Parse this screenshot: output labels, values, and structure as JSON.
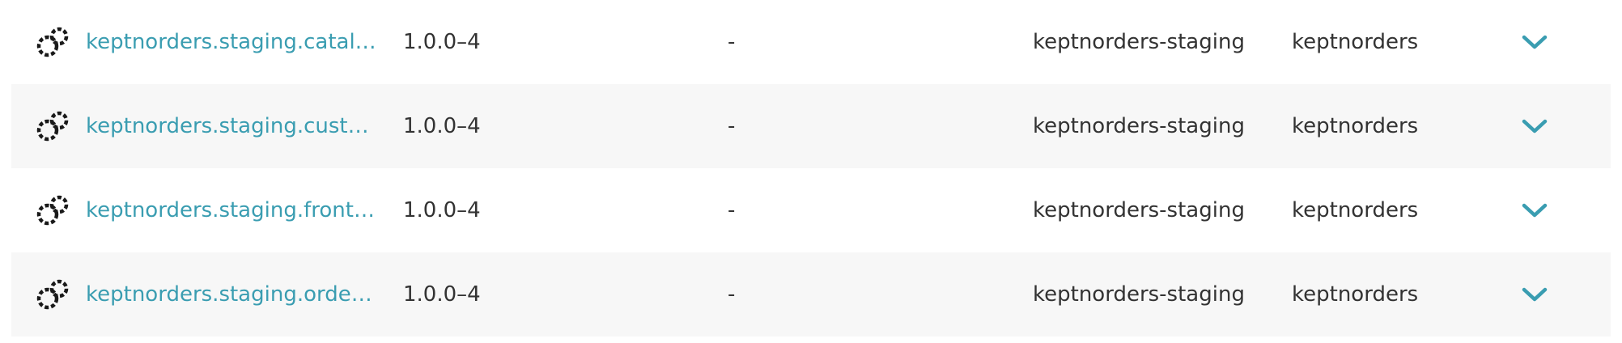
{
  "rows": [
    {
      "name": "keptnorders.staging.catal…",
      "version": "1.0.0–4",
      "value": "-",
      "namespace": "keptnorders-staging",
      "app": "keptnorders",
      "icon": "workload-cycle-icon",
      "expand_icon": "chevron-down-icon"
    },
    {
      "name": "keptnorders.staging.cust…",
      "version": "1.0.0–4",
      "value": "-",
      "namespace": "keptnorders-staging",
      "app": "keptnorders",
      "icon": "workload-cycle-icon",
      "expand_icon": "chevron-down-icon"
    },
    {
      "name": "keptnorders.staging.front…",
      "version": "1.0.0–4",
      "value": "-",
      "namespace": "keptnorders-staging",
      "app": "keptnorders",
      "icon": "workload-cycle-icon",
      "expand_icon": "chevron-down-icon"
    },
    {
      "name": "keptnorders.staging.orde…",
      "version": "1.0.0–4",
      "value": "-",
      "namespace": "keptnorders-staging",
      "app": "keptnorders",
      "icon": "workload-cycle-icon",
      "expand_icon": "chevron-down-icon"
    }
  ],
  "colors": {
    "link": "#3a9db1",
    "text": "#333333",
    "row_alt": "#f7f7f7",
    "icon": "#1a1a1a"
  }
}
